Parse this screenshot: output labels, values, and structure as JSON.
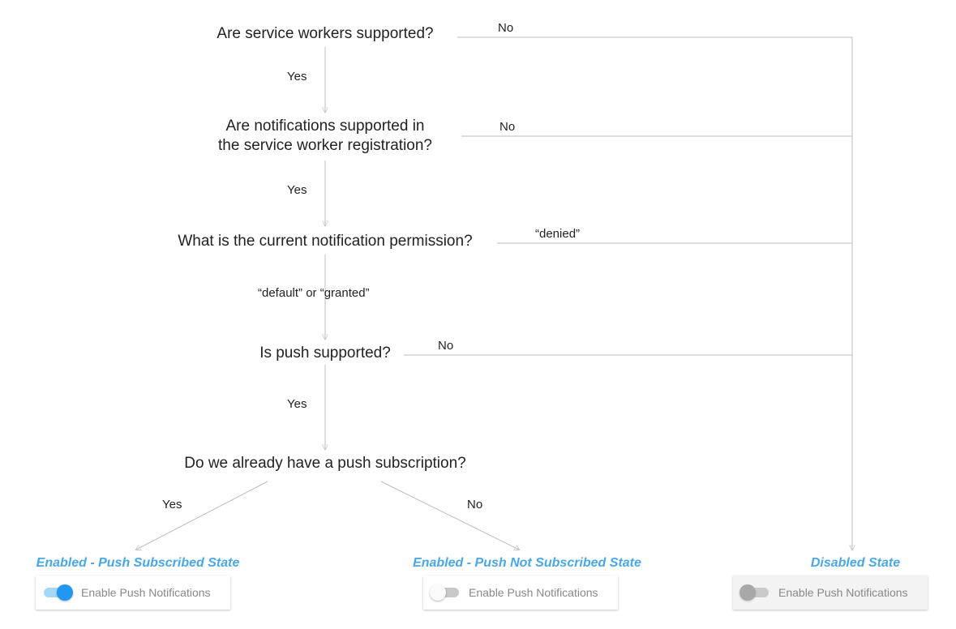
{
  "nodes": {
    "q1": "Are service workers supported?",
    "q2": "Are notifications supported in\nthe service worker registration?",
    "q3": "What is the current notification permission?",
    "q4": "Is push supported?",
    "q5": "Do we already have a push subscription?"
  },
  "edges": {
    "q1_yes": "Yes",
    "q1_no": "No",
    "q2_yes": "Yes",
    "q2_no": "No",
    "q3_pass": "“default” or “granted”",
    "q3_denied": "“denied”",
    "q4_yes": "Yes",
    "q4_no": "No",
    "q5_yes": "Yes",
    "q5_no": "No"
  },
  "states": {
    "subscribed": {
      "title": "Enabled - Push Subscribed State",
      "toggle_label": "Enable Push Notifications",
      "toggle": "on"
    },
    "not_subscribed": {
      "title": "Enabled - Push Not Subscribed State",
      "toggle_label": "Enable Push Notifications",
      "toggle": "off"
    },
    "disabled": {
      "title": "Disabled State",
      "toggle_label": "Enable Push Notifications",
      "toggle": "disabled"
    }
  },
  "colors": {
    "accent": "#4aa7e6",
    "line": "#bdbdbd",
    "toggle_on": "#2196f3",
    "toggle_on_track": "#a3d8f7",
    "toggle_off_track": "#c8c8c8",
    "toggle_disabled_knob": "#a8a8a8"
  }
}
